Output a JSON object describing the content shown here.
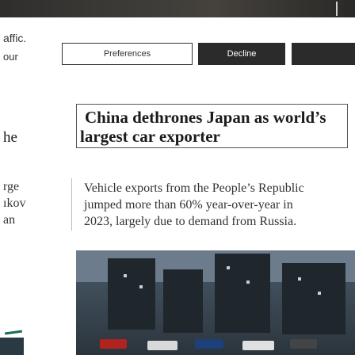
{
  "cookie_banner": {
    "left_fragment_1": "affic.",
    "left_fragment_2": "our",
    "preferences_label": "Preferences",
    "decline_label": "Decline",
    "accept_label": ""
  },
  "article": {
    "headline_line1": "China dethrones Japan as world’s",
    "headline_line2": "largest car exporter",
    "dek_line1": "Vehicle exports from the People’s Republic",
    "dek_line2": "jumped more than 60% year-over-year in",
    "dek_line3": "2023, largely due to demand from Russia."
  },
  "left_column": {
    "frag_he": "he",
    "frag_rge": "rge",
    "frag_kov": "ıkov",
    "frag_an": "an"
  },
  "colors": {
    "dark_button": "#2b2b2b",
    "text": "#222222"
  }
}
